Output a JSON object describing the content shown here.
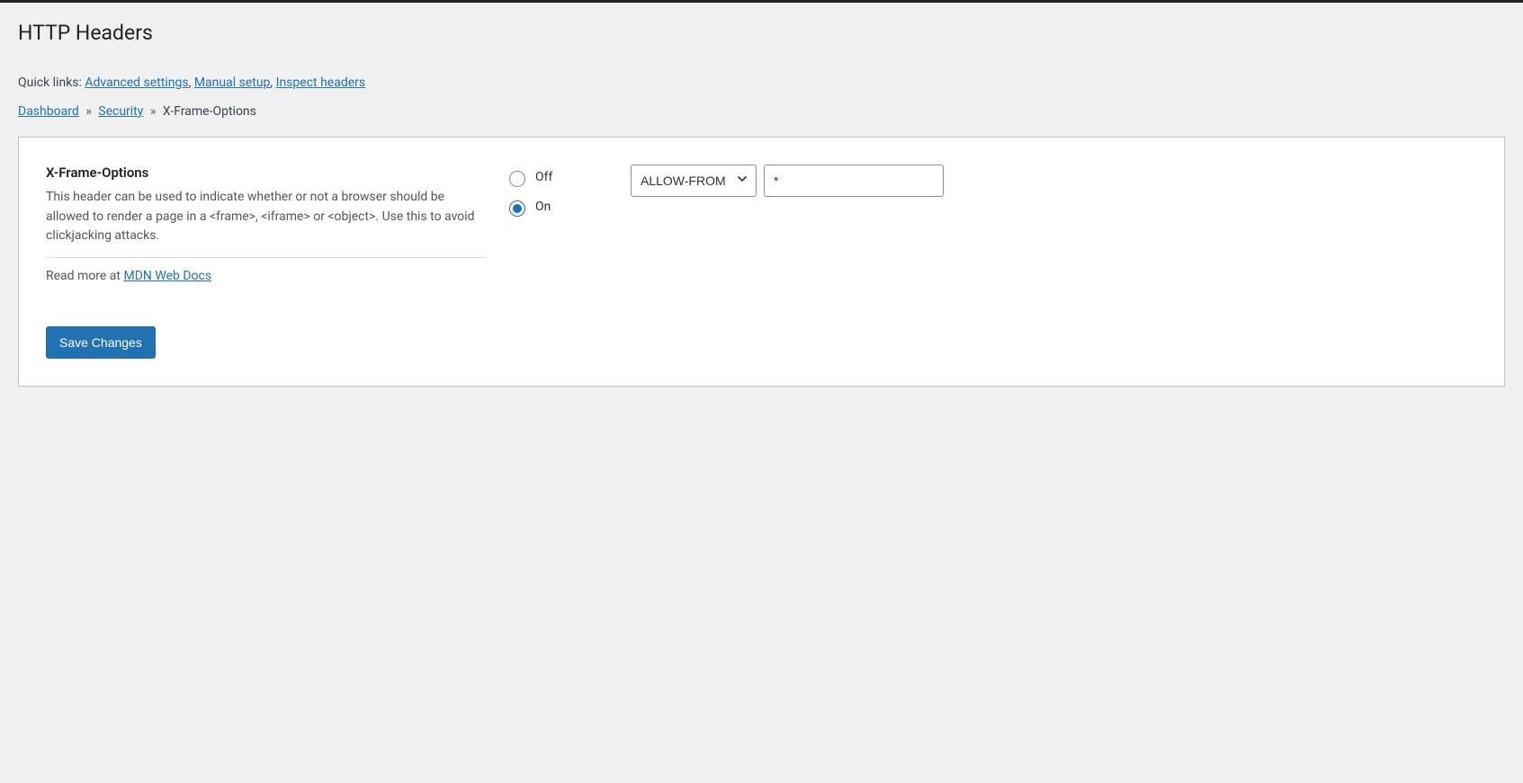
{
  "page": {
    "title": "HTTP Headers"
  },
  "quicklinks": {
    "label": "Quick links: ",
    "advanced": "Advanced settings",
    "manual": "Manual setup",
    "inspect": "Inspect headers"
  },
  "breadcrumb": {
    "dashboard": "Dashboard",
    "security": "Security",
    "current": "X-Frame-Options",
    "sep": "»"
  },
  "header": {
    "title": "X-Frame-Options",
    "description": "This header can be used to indicate whether or not a browser should be allowed to render a page in a <frame>, <iframe> or <object>. Use this to avoid clickjacking attacks.",
    "read_more_label": "Read more at ",
    "read_more_link": "MDN Web Docs"
  },
  "toggle": {
    "off_label": "Off",
    "on_label": "On",
    "value": "on"
  },
  "value_select": {
    "selected": "ALLOW-FROM"
  },
  "value_input": {
    "value": "*"
  },
  "actions": {
    "save": "Save Changes"
  }
}
